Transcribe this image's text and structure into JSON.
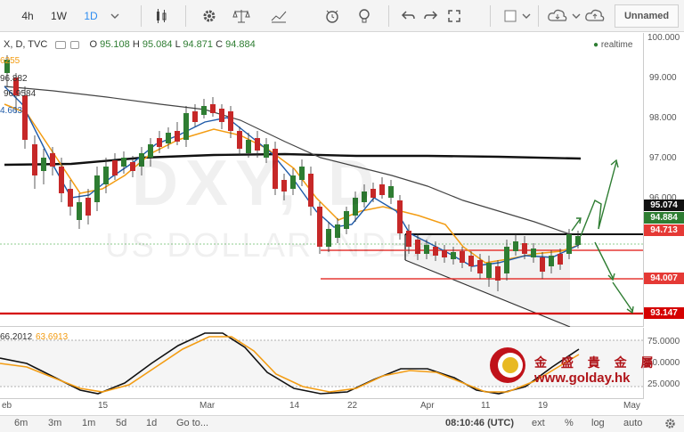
{
  "toolbar": {
    "intervals": [
      "4h",
      "1W",
      "1D"
    ],
    "selected_interval": "1D",
    "layout_name": "Unnamed"
  },
  "chart": {
    "symbol_label": "X, D, TVC",
    "ohlc": {
      "o_label": "O",
      "o": "95.108",
      "h_label": "H",
      "h": "95.084",
      "l_label": "L",
      "l": "94.871",
      "c_label": "C",
      "c": "94.884"
    },
    "realtime_label": "realtime",
    "watermark_symbol": "DXY, D",
    "watermark_name": "US DOLLAR INDEX",
    "indicator_values": [
      "6255",
      "96.882",
      "96.9584",
      "4.663"
    ],
    "osc_legend": {
      "value1": "66.2012",
      "value2": "63.6913"
    }
  },
  "price_axis": {
    "labels": [
      "100.000",
      "99.000",
      "98.000",
      "97.000",
      "96.000",
      "95.000",
      "94.000",
      "93.000"
    ],
    "tags": [
      {
        "value": "95.074",
        "color": "#111111"
      },
      {
        "value": "94.884",
        "color": "#2e7d32"
      },
      {
        "value": "94.713",
        "color": "#e53935"
      },
      {
        "value": "94.007",
        "color": "#e53935"
      },
      {
        "value": "93.147",
        "color": "#d50000"
      }
    ]
  },
  "osc_axis": {
    "labels": [
      "75.0000",
      "50.0000",
      "25.0000"
    ]
  },
  "time_axis": {
    "labels": [
      "eb",
      "15",
      "Mar",
      "14",
      "22",
      "Apr",
      "11",
      "19",
      "May"
    ]
  },
  "bottom_bar": {
    "ranges": [
      "6m",
      "3m",
      "1m",
      "5d",
      "1d"
    ],
    "goto": "Go to...",
    "clock": "08:10:46 (UTC)",
    "ext": "ext",
    "percent": "%",
    "log": "log",
    "auto": "auto"
  },
  "branding": {
    "title": "金 盛 貴 金 屬",
    "url": "www.golday.hk"
  },
  "colors": {
    "bull": "#2e7d32",
    "bear": "#c62828",
    "accent": "#2d8cf0",
    "ma_orange": "#f39c12",
    "ma_blue": "#1e5aa8"
  }
}
